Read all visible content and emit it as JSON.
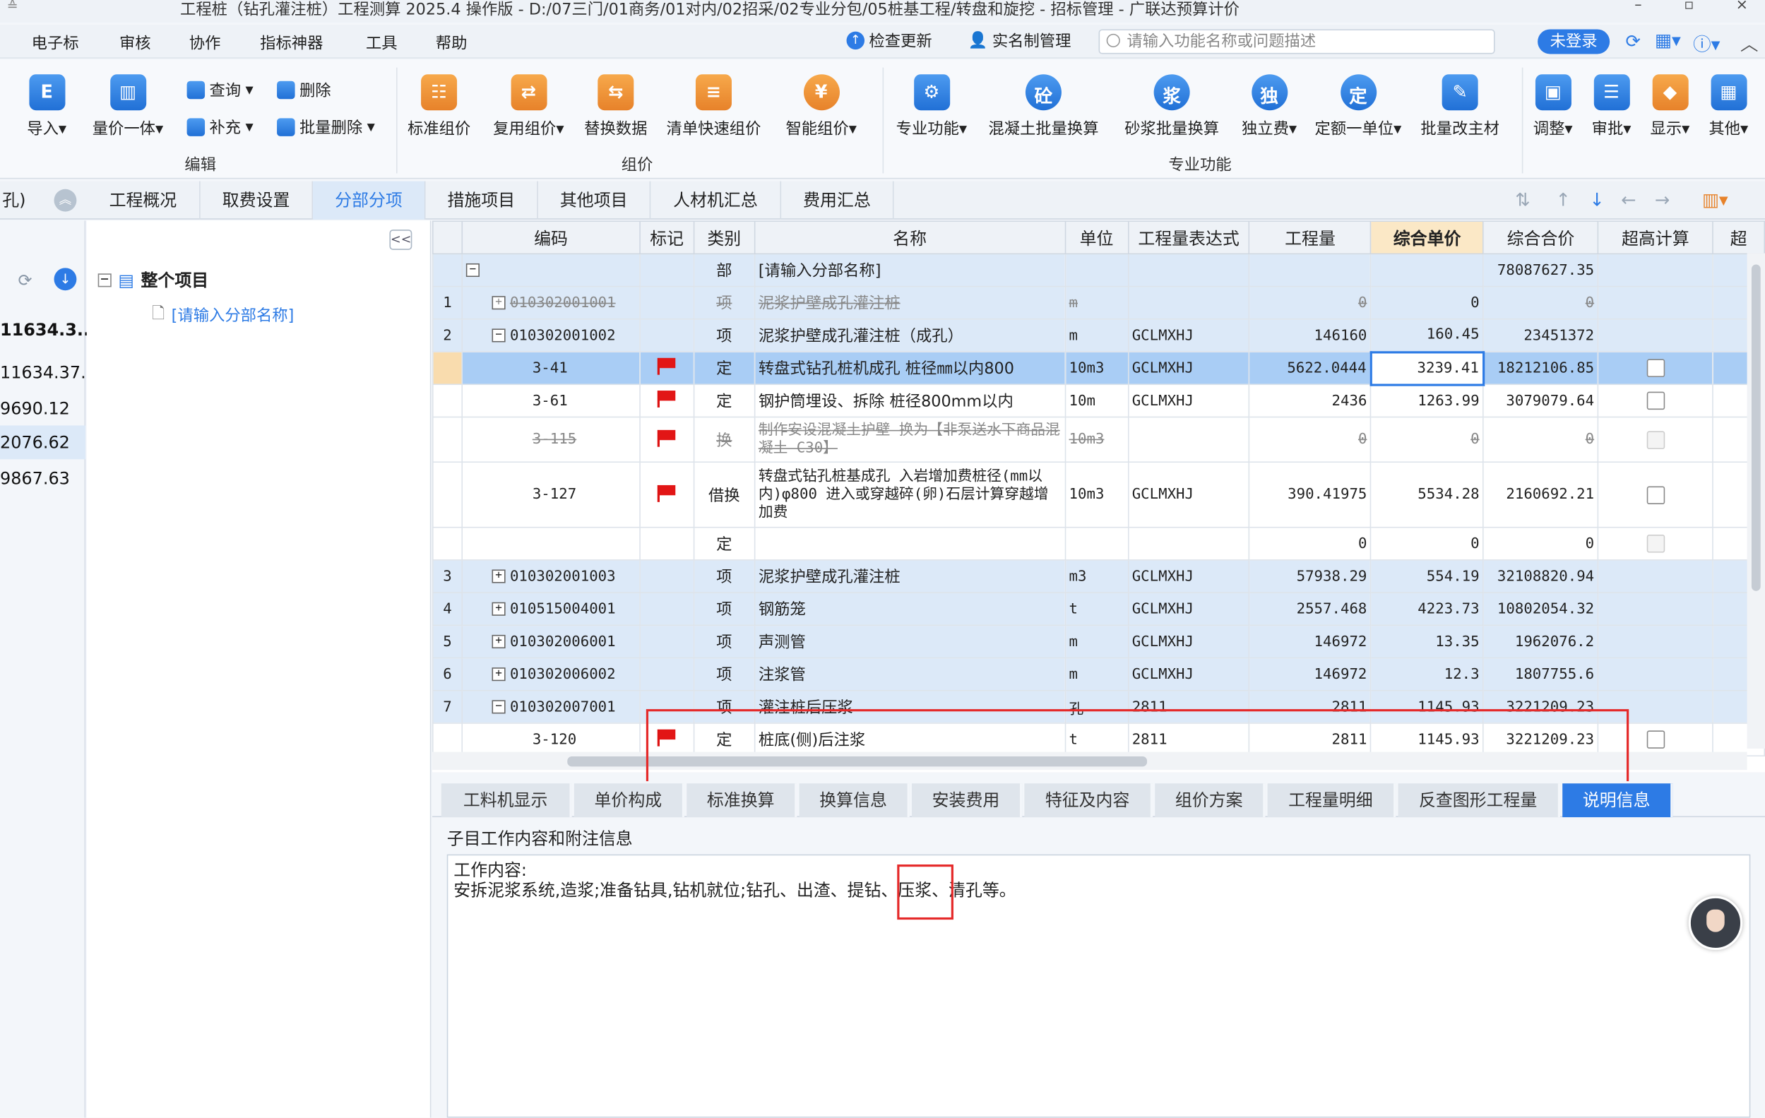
{
  "titlebar": {
    "title": "工程桩（钻孔灌注桩）工程测算 2025.4 操作版 - D:/07三门/01商务/01对内/02招采/02专业分包/05桩基工程/转盘和旋挖 - 招标管理 - 广联达预算计价",
    "restore": "▫",
    "close": "×",
    "minimize": "–",
    "sys": "≙"
  },
  "menu": {
    "items": [
      "电子标",
      "审核",
      "协作",
      "指标神器",
      "工具",
      "帮助"
    ],
    "check_update": "检查更新",
    "realname": "实名制管理",
    "search_placeholder": "请输入功能名称或问题描述",
    "login": "未登录"
  },
  "ribbon": {
    "import": "导入",
    "qty_price": "量价一体",
    "query": "查询",
    "delete": "删除",
    "supplement": "补充",
    "batch_delete": "批量删除",
    "group_edit": "编辑",
    "std_group": "标准组价",
    "reuse_group": "复用组价",
    "replace_data": "替换数据",
    "quick_group": "清单快速组价",
    "smart_group": "智能组价",
    "group_group": "组价",
    "pro_func": "专业功能",
    "concrete_batch": "混凝土批量换算",
    "mortar_batch": "砂浆批量换算",
    "independent_fee": "独立费",
    "quota_unit": "定额一单位",
    "batch_main": "批量改主材",
    "group_pro": "专业功能",
    "adjust": "调整",
    "review": "审批",
    "display": "显示",
    "other": "其他",
    "g_concrete": "砼",
    "g_mortar": "浆",
    "g_indep": "独",
    "g_quota": "定"
  },
  "tabs": {
    "left_label": "孔)",
    "items": [
      "工程概况",
      "取费设置",
      "分部分项",
      "措施项目",
      "其他项目",
      "人材机汇总",
      "费用汇总"
    ]
  },
  "left_values": [
    "11634.3...",
    "11634.37...",
    "9690.12",
    "2076.62",
    "9867.63"
  ],
  "tree": {
    "root": "整个项目",
    "child": "[请输入分部名称]",
    "collapse": "<<"
  },
  "grid": {
    "headers": [
      "编码",
      "标记",
      "类别",
      "名称",
      "单位",
      "工程量表达式",
      "工程量",
      "综合单价",
      "综合合价",
      "超高计算"
    ],
    "rows": [
      {
        "no": "",
        "code": "",
        "type": "部",
        "name": "[请输入分部名称]",
        "unit": "",
        "expr": "",
        "qty": "",
        "price": "",
        "total": "78087627.35"
      },
      {
        "no": "1",
        "code": "010302001001",
        "type": "项",
        "name": "泥浆护壁成孔灌注桩",
        "unit": "m",
        "expr": "",
        "qty": "0",
        "price": "0",
        "total": "0"
      },
      {
        "no": "2",
        "code": "010302001002",
        "type": "项",
        "name": "泥浆护壁成孔灌注桩（成孔）",
        "unit": "m",
        "expr": "GCLMXHJ",
        "qty": "146160",
        "price": "160.45",
        "total": "23451372"
      },
      {
        "no": "",
        "code": "3-41",
        "type": "定",
        "name": "转盘式钻孔桩机成孔 桩径㎜以内800",
        "unit": "10m3",
        "expr": "GCLMXHJ",
        "qty": "5622.0444",
        "price": "3239.41",
        "total": "18212106.85"
      },
      {
        "no": "",
        "code": "3-61",
        "type": "定",
        "name": "钢护筒埋设、拆除 桩径800mm以内",
        "unit": "10m",
        "expr": "GCLMXHJ",
        "qty": "2436",
        "price": "1263.99",
        "total": "3079079.64"
      },
      {
        "no": "",
        "code": "3-115",
        "type": "换",
        "name": "制作安设混凝土护壁 换为【非泵送水下商品混凝土 C30】",
        "unit": "10m3",
        "expr": "",
        "qty": "0",
        "price": "0",
        "total": "0"
      },
      {
        "no": "",
        "code": "3-127",
        "type": "借换",
        "name": "转盘式钻孔桩基成孔 入岩增加费桩径(mm以内)φ800 进入或穿越碎(卵)石层计算穿越增加费",
        "unit": "10m3",
        "expr": "GCLMXHJ",
        "qty": "390.41975",
        "price": "5534.28",
        "total": "2160692.21"
      },
      {
        "no": "",
        "code": "",
        "type": "定",
        "name": "",
        "unit": "",
        "expr": "",
        "qty": "0",
        "price": "0",
        "total": "0"
      },
      {
        "no": "3",
        "code": "010302001003",
        "type": "项",
        "name": "泥浆护壁成孔灌注桩",
        "unit": "m3",
        "expr": "GCLMXHJ",
        "qty": "57938.29",
        "price": "554.19",
        "total": "32108820.94"
      },
      {
        "no": "4",
        "code": "010515004001",
        "type": "项",
        "name": "钢筋笼",
        "unit": "t",
        "expr": "GCLMXHJ",
        "qty": "2557.468",
        "price": "4223.73",
        "total": "10802054.32"
      },
      {
        "no": "5",
        "code": "010302006001",
        "type": "项",
        "name": "声测管",
        "unit": "m",
        "expr": "GCLMXHJ",
        "qty": "146972",
        "price": "13.35",
        "total": "1962076.2"
      },
      {
        "no": "6",
        "code": "010302006002",
        "type": "项",
        "name": "注浆管",
        "unit": "m",
        "expr": "GCLMXHJ",
        "qty": "146972",
        "price": "12.3",
        "total": "1807755.6"
      },
      {
        "no": "7",
        "code": "010302007001",
        "type": "项",
        "name": "灌注桩后压浆",
        "unit": "孔",
        "expr": "2811",
        "qty": "2811",
        "price": "1145.93",
        "total": "3221209.23"
      },
      {
        "no": "",
        "code": "3-120",
        "type": "定",
        "name": "桩底(侧)后注浆",
        "unit": "t",
        "expr": "2811",
        "qty": "2811",
        "price": "1145.93",
        "total": "3221209.23"
      }
    ]
  },
  "bottom_tabs": [
    "工料机显示",
    "单价构成",
    "标准换算",
    "换算信息",
    "安装费用",
    "特征及内容",
    "组价方案",
    "工程量明细",
    "反查图形工程量",
    "说明信息"
  ],
  "desc": {
    "label": "子目工作内容和附注信息",
    "line1": "工作内容:",
    "line2_a": "安拆泥浆系统,造浆;准备钻具,钻机就位;钻孔、出渣、提钻、",
    "line2_b": "压浆",
    "line2_c": "、清孔等。"
  },
  "colors": {
    "accent": "#2d7be5",
    "highlight_box": "#e52a2a",
    "flag": "#e21616"
  }
}
